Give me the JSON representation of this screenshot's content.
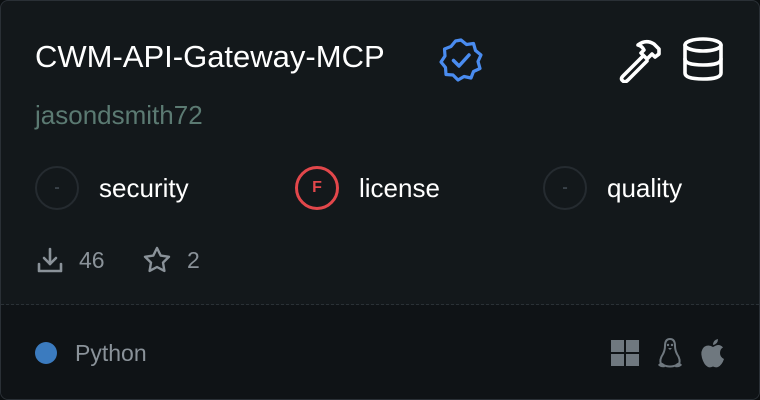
{
  "server": {
    "name": "CWM-API-Gateway-MCP",
    "author": "jasondsmith72",
    "verified_icon": "verified-badge-icon",
    "feature_icons": [
      "hammer-icon",
      "database-icon"
    ]
  },
  "scores": [
    {
      "label": "security",
      "grade": "-",
      "status": "none"
    },
    {
      "label": "license",
      "grade": "F",
      "status": "fail",
      "color": "#e2474b"
    },
    {
      "label": "quality",
      "grade": "-",
      "status": "none"
    }
  ],
  "stats": {
    "downloads": "46",
    "stars": "2",
    "download_icon": "download-icon",
    "star_icon": "star-icon"
  },
  "footer": {
    "language": "Python",
    "language_color": "#3b7bbf",
    "platform_icons": [
      "windows-icon",
      "linux-icon",
      "apple-icon"
    ]
  },
  "colors": {
    "background": "#13181b",
    "footer_background": "#0f1316",
    "accent_verified": "#4a8cf0",
    "fail": "#e2474b",
    "author": "#5b7a72"
  }
}
